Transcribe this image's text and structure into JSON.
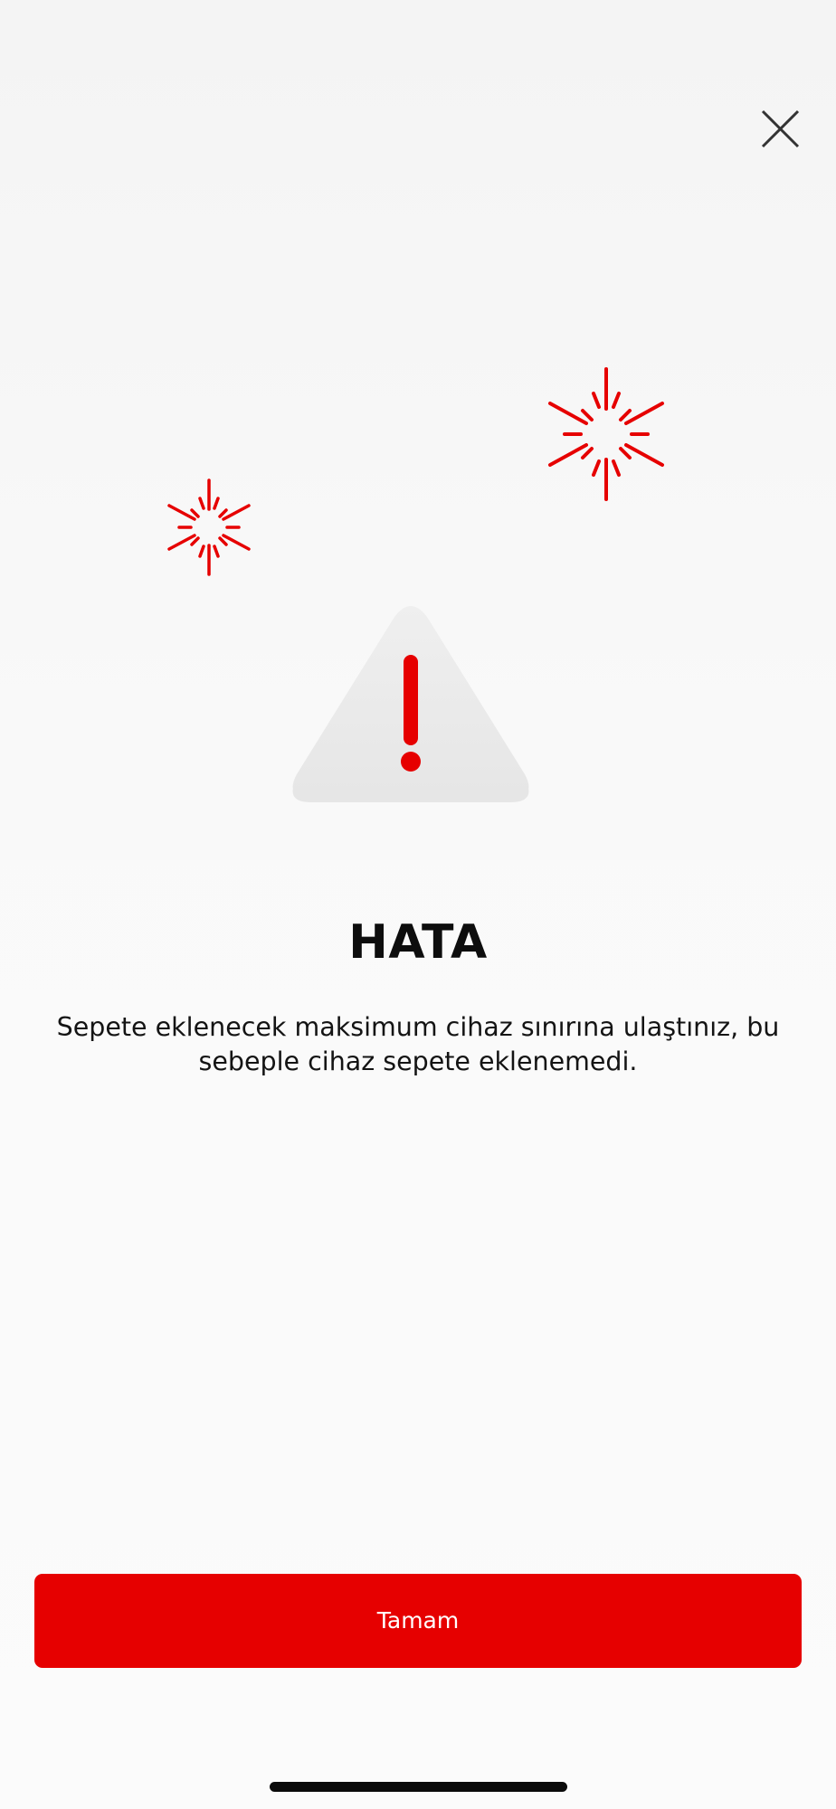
{
  "dialog": {
    "close_icon": "close-icon",
    "illustration_icon": "warning-triangle-icon",
    "decoration_icon": "sparkle-icon",
    "title": "HATA",
    "message": "Sepete eklenecek maksimum cihaz sınırına ulaştınız, bu sebeple cihaz sepete eklenemedi.",
    "ok_label": "Tamam"
  },
  "colors": {
    "accent": "#e60000",
    "background": "#f7f7f7",
    "triangle": "#ececec",
    "text": "#0d0d0d"
  }
}
